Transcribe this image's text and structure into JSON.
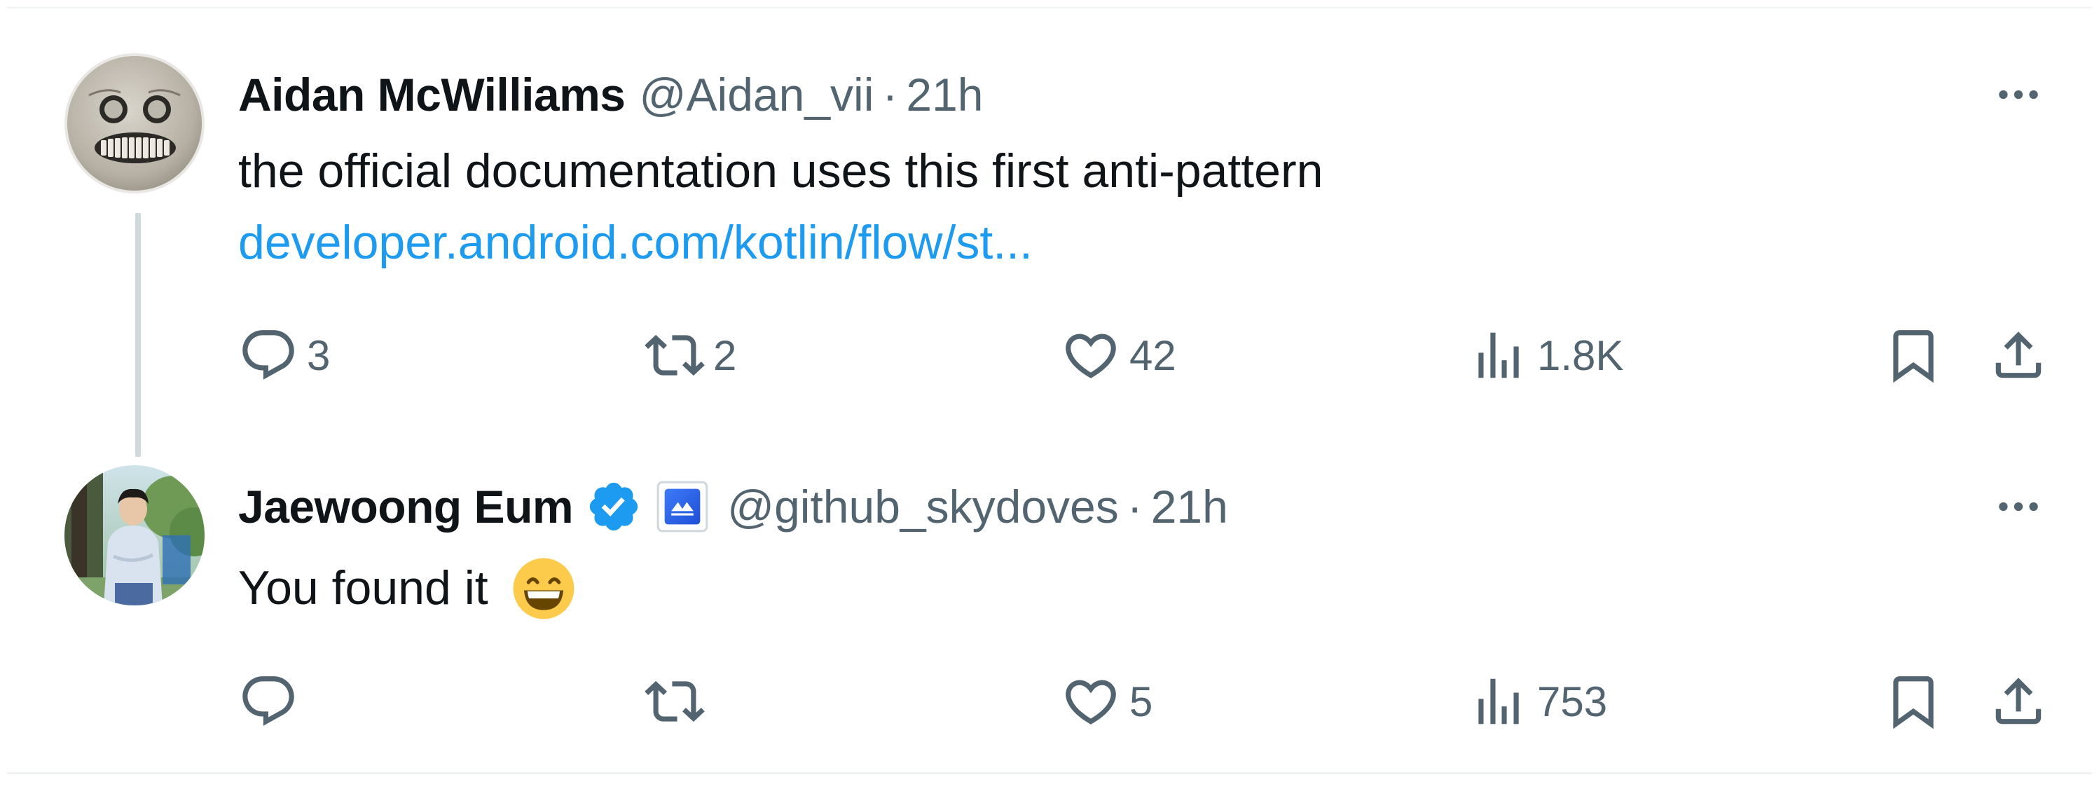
{
  "tweets": [
    {
      "author_name": "Aidan McWilliams",
      "handle": "@Aidan_vii",
      "separator": "·",
      "time": "21h",
      "text": "the official documentation uses this first anti-pattern",
      "link_text": "developer.android.com/kotlin/flow/st...",
      "avatar_icon": "masked-face-avatar",
      "actions": {
        "replies": "3",
        "reposts": "2",
        "likes": "42",
        "views": "1.8K"
      }
    },
    {
      "author_name": "Jaewoong Eum",
      "verified": true,
      "affiliation_icon": "organization-badge-icon",
      "handle": "@github_skydoves",
      "separator": "·",
      "time": "21h",
      "text": "You found it",
      "emoji": "😄",
      "avatar_icon": "person-photo-avatar",
      "actions": {
        "replies": "",
        "reposts": "",
        "likes": "5",
        "views": "753"
      }
    }
  ],
  "colors": {
    "text_primary": "#0f1419",
    "text_secondary": "#536471",
    "link": "#1d9bf0",
    "verified": "#1d9bf0",
    "thread_line": "#cfd9de",
    "border": "#eff3f4"
  }
}
